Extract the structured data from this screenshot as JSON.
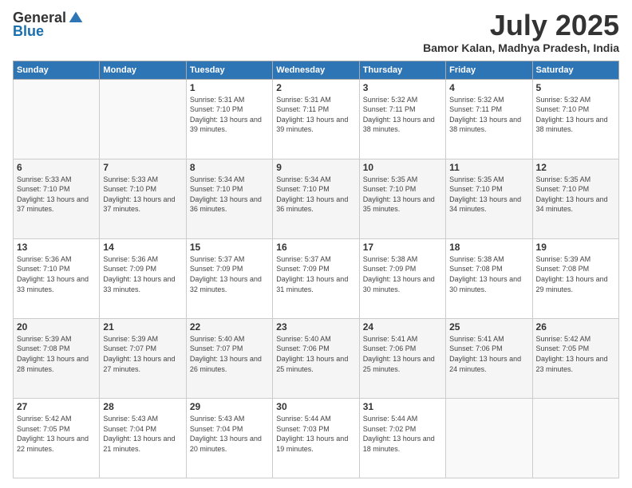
{
  "header": {
    "logo_general": "General",
    "logo_blue": "Blue",
    "month_year": "July 2025",
    "location": "Bamor Kalan, Madhya Pradesh, India"
  },
  "days_of_week": [
    "Sunday",
    "Monday",
    "Tuesday",
    "Wednesday",
    "Thursday",
    "Friday",
    "Saturday"
  ],
  "weeks": [
    [
      {
        "day": "",
        "info": ""
      },
      {
        "day": "",
        "info": ""
      },
      {
        "day": "1",
        "sunrise": "5:31 AM",
        "sunset": "7:10 PM",
        "daylight": "13 hours and 39 minutes."
      },
      {
        "day": "2",
        "sunrise": "5:31 AM",
        "sunset": "7:11 PM",
        "daylight": "13 hours and 39 minutes."
      },
      {
        "day": "3",
        "sunrise": "5:32 AM",
        "sunset": "7:11 PM",
        "daylight": "13 hours and 38 minutes."
      },
      {
        "day": "4",
        "sunrise": "5:32 AM",
        "sunset": "7:11 PM",
        "daylight": "13 hours and 38 minutes."
      },
      {
        "day": "5",
        "sunrise": "5:32 AM",
        "sunset": "7:10 PM",
        "daylight": "13 hours and 38 minutes."
      }
    ],
    [
      {
        "day": "6",
        "sunrise": "5:33 AM",
        "sunset": "7:10 PM",
        "daylight": "13 hours and 37 minutes."
      },
      {
        "day": "7",
        "sunrise": "5:33 AM",
        "sunset": "7:10 PM",
        "daylight": "13 hours and 37 minutes."
      },
      {
        "day": "8",
        "sunrise": "5:34 AM",
        "sunset": "7:10 PM",
        "daylight": "13 hours and 36 minutes."
      },
      {
        "day": "9",
        "sunrise": "5:34 AM",
        "sunset": "7:10 PM",
        "daylight": "13 hours and 36 minutes."
      },
      {
        "day": "10",
        "sunrise": "5:35 AM",
        "sunset": "7:10 PM",
        "daylight": "13 hours and 35 minutes."
      },
      {
        "day": "11",
        "sunrise": "5:35 AM",
        "sunset": "7:10 PM",
        "daylight": "13 hours and 34 minutes."
      },
      {
        "day": "12",
        "sunrise": "5:35 AM",
        "sunset": "7:10 PM",
        "daylight": "13 hours and 34 minutes."
      }
    ],
    [
      {
        "day": "13",
        "sunrise": "5:36 AM",
        "sunset": "7:10 PM",
        "daylight": "13 hours and 33 minutes."
      },
      {
        "day": "14",
        "sunrise": "5:36 AM",
        "sunset": "7:09 PM",
        "daylight": "13 hours and 33 minutes."
      },
      {
        "day": "15",
        "sunrise": "5:37 AM",
        "sunset": "7:09 PM",
        "daylight": "13 hours and 32 minutes."
      },
      {
        "day": "16",
        "sunrise": "5:37 AM",
        "sunset": "7:09 PM",
        "daylight": "13 hours and 31 minutes."
      },
      {
        "day": "17",
        "sunrise": "5:38 AM",
        "sunset": "7:09 PM",
        "daylight": "13 hours and 30 minutes."
      },
      {
        "day": "18",
        "sunrise": "5:38 AM",
        "sunset": "7:08 PM",
        "daylight": "13 hours and 30 minutes."
      },
      {
        "day": "19",
        "sunrise": "5:39 AM",
        "sunset": "7:08 PM",
        "daylight": "13 hours and 29 minutes."
      }
    ],
    [
      {
        "day": "20",
        "sunrise": "5:39 AM",
        "sunset": "7:08 PM",
        "daylight": "13 hours and 28 minutes."
      },
      {
        "day": "21",
        "sunrise": "5:39 AM",
        "sunset": "7:07 PM",
        "daylight": "13 hours and 27 minutes."
      },
      {
        "day": "22",
        "sunrise": "5:40 AM",
        "sunset": "7:07 PM",
        "daylight": "13 hours and 26 minutes."
      },
      {
        "day": "23",
        "sunrise": "5:40 AM",
        "sunset": "7:06 PM",
        "daylight": "13 hours and 25 minutes."
      },
      {
        "day": "24",
        "sunrise": "5:41 AM",
        "sunset": "7:06 PM",
        "daylight": "13 hours and 25 minutes."
      },
      {
        "day": "25",
        "sunrise": "5:41 AM",
        "sunset": "7:06 PM",
        "daylight": "13 hours and 24 minutes."
      },
      {
        "day": "26",
        "sunrise": "5:42 AM",
        "sunset": "7:05 PM",
        "daylight": "13 hours and 23 minutes."
      }
    ],
    [
      {
        "day": "27",
        "sunrise": "5:42 AM",
        "sunset": "7:05 PM",
        "daylight": "13 hours and 22 minutes."
      },
      {
        "day": "28",
        "sunrise": "5:43 AM",
        "sunset": "7:04 PM",
        "daylight": "13 hours and 21 minutes."
      },
      {
        "day": "29",
        "sunrise": "5:43 AM",
        "sunset": "7:04 PM",
        "daylight": "13 hours and 20 minutes."
      },
      {
        "day": "30",
        "sunrise": "5:44 AM",
        "sunset": "7:03 PM",
        "daylight": "13 hours and 19 minutes."
      },
      {
        "day": "31",
        "sunrise": "5:44 AM",
        "sunset": "7:02 PM",
        "daylight": "13 hours and 18 minutes."
      },
      {
        "day": "",
        "info": ""
      },
      {
        "day": "",
        "info": ""
      }
    ]
  ],
  "labels": {
    "sunrise_label": "Sunrise:",
    "sunset_label": "Sunset:",
    "daylight_label": "Daylight:"
  }
}
